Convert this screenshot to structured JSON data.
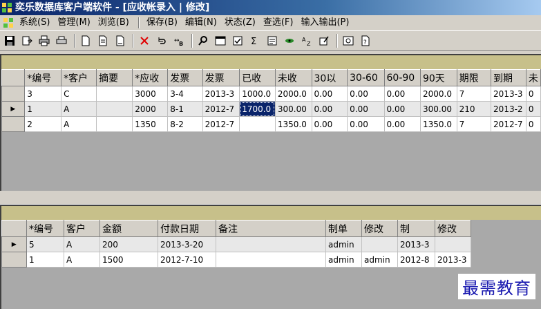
{
  "window": {
    "title": "奕乐数据库客户端软件 - [应收帐录入 | 修改]"
  },
  "menu": {
    "items": [
      "系统(S)",
      "管理(M)",
      "浏览(B)",
      "保存(B)",
      "编辑(N)",
      "状态(Z)",
      "查选(F)",
      "输入输出(P)"
    ]
  },
  "toolbar": {
    "buttons": [
      "save-icon",
      "export-icon",
      "print-icon",
      "print-preview-icon",
      "new-document-icon",
      "copy-document-icon",
      "paste-document-icon",
      "delete-icon",
      "undo-icon",
      "replace-icon",
      "find-icon",
      "window-icon",
      "checkbox-icon",
      "sum-icon",
      "filter-icon",
      "view-icon",
      "sort-icon",
      "edit-form-icon",
      "snapshot-icon",
      "help-icon"
    ]
  },
  "top_grid": {
    "columns": [
      "*编号",
      "*客户",
      "摘要",
      "*应收",
      "发票",
      "发票",
      "已收",
      "未收",
      "30以",
      "30-60",
      "60-90",
      "90天",
      "期限",
      "到期",
      "未"
    ],
    "rows": [
      {
        "indicator": "",
        "cells": [
          "3",
          "C",
          "",
          "3000",
          "3-4",
          "2013-3",
          "1000.0",
          "2000.0",
          "0.00",
          "0.00",
          "0.00",
          "2000.0",
          "7",
          "2013-3",
          "0"
        ]
      },
      {
        "indicator": "▶",
        "cells": [
          "1",
          "A",
          "",
          "2000",
          "8-1",
          "2012-7",
          "1700.0",
          "300.00",
          "0.00",
          "0.00",
          "0.00",
          "300.00",
          "210",
          "2013-2",
          "0"
        ]
      },
      {
        "indicator": "",
        "cells": [
          "2",
          "A",
          "",
          "1350",
          "8-2",
          "2012-7",
          "",
          "1350.0",
          "0.00",
          "0.00",
          "0.00",
          "1350.0",
          "7",
          "2012-7",
          "0"
        ]
      }
    ]
  },
  "bottom_grid": {
    "columns": [
      "*编号",
      "客户",
      "金额",
      "付款日期",
      "备注",
      "制单",
      "修改",
      "制",
      "修改"
    ],
    "rows": [
      {
        "indicator": "▶",
        "cells": [
          "5",
          "A",
          "200",
          "2013-3-20",
          "",
          "admin",
          "",
          "2013-3",
          ""
        ]
      },
      {
        "indicator": "",
        "cells": [
          "1",
          "A",
          "1500",
          "2012-7-10",
          "",
          "admin",
          "admin",
          "2012-8",
          "2013-3"
        ]
      }
    ]
  },
  "watermark": "最需教育"
}
